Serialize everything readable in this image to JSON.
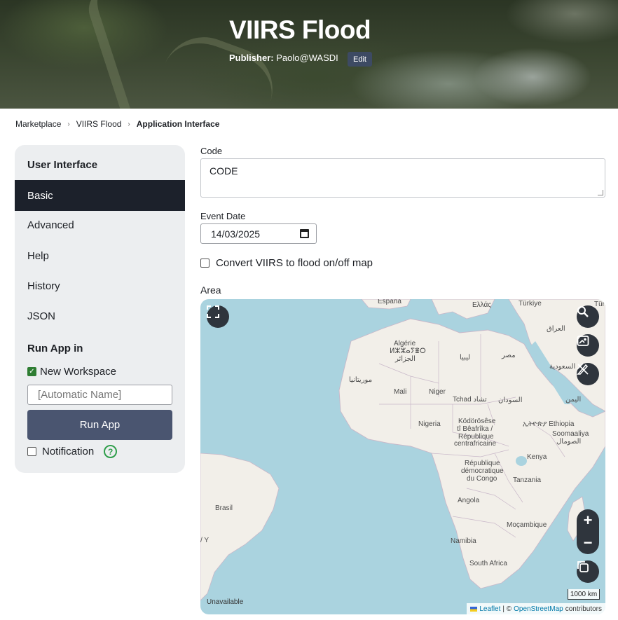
{
  "header": {
    "title": "VIIRS Flood",
    "publisher_label": "Publisher:",
    "publisher": "Paolo@WASDI",
    "edit_label": "Edit"
  },
  "breadcrumb": {
    "items": [
      "Marketplace",
      "VIIRS Flood",
      "Application Interface"
    ],
    "separator": "›"
  },
  "sidebar": {
    "title": "User Interface",
    "items": [
      {
        "label": "Basic",
        "active": true
      },
      {
        "label": "Advanced"
      },
      {
        "label": "Help"
      },
      {
        "label": "History"
      },
      {
        "label": "JSON"
      }
    ],
    "run_title": "Run App in",
    "new_workspace_label": "New Workspace",
    "new_workspace_checked": true,
    "workspace_name_placeholder": "[Automatic Name]",
    "run_button": "Run App",
    "notification_label": "Notification",
    "notification_checked": false,
    "help_icon": "?"
  },
  "form": {
    "code_label": "Code",
    "code_value": "CODE",
    "event_date_label": "Event Date",
    "event_date_value": "14/03/2025",
    "convert_label": "Convert VIIRS to flood on/off map",
    "convert_checked": false,
    "area_label": "Area"
  },
  "map": {
    "labels": {
      "espana": "España",
      "ellas": "Ελλάς",
      "turkiye": "Türkiye",
      "turk": "Türk",
      "algerie": "Algérie",
      "algerie_tif": "ⵍⵣⵣⴰⵢⴻⵔ",
      "algerie_ar": "الجزائر",
      "libya": "ليبيا",
      "misr": "مصر",
      "iraq": "العراق",
      "saudi": "السعودية",
      "mauritania": "موريتانيا",
      "mali": "Mali",
      "niger": "Niger",
      "tchad": "Tchad تشاد",
      "sudan": "السودان",
      "yemen": "اليمن",
      "nigeria": "Nigeria",
      "car1": "Ködörösêse",
      "car2": "tî Bêafrîka /",
      "car3": "République",
      "car4": "centrafricaine",
      "ethiopia": "ኢትዮጵያ Ethiopia",
      "somalia1": "Soomaaliya",
      "somalia2": "الصومال",
      "drc1": "République",
      "drc2": "démocratique",
      "drc3": "du Congo",
      "kenya": "Kenya",
      "tanzania": "Tanzania",
      "angola": "Angola",
      "brasil": "Brasil",
      "namibia": "Namibia",
      "mocambique": "Moçambique",
      "south_africa": "South Africa",
      "edge_y": "/ Y"
    },
    "scale": "1000 km",
    "attribution_leaflet": "Leaflet",
    "attribution_sep": "| ©",
    "attribution_osm": "OpenStreetMap",
    "attribution_tail": "contributors",
    "unavailable": "Unavailable",
    "zoom_in": "+",
    "zoom_out": "−",
    "buttons": [
      "fullscreen-icon",
      "search-icon",
      "image-export-icon",
      "draw-edit-icon",
      "layers-icon"
    ]
  }
}
